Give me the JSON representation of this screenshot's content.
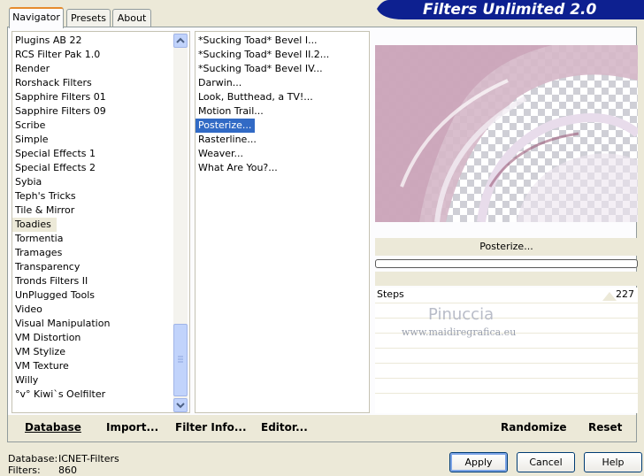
{
  "tabs": [
    "Navigator",
    "Presets",
    "About"
  ],
  "header": {
    "title": "Filters Unlimited 2.0"
  },
  "categories": [
    "Plugins AB 22",
    "RCS Filter Pak 1.0",
    "Render",
    "Rorshack Filters",
    "Sapphire Filters 01",
    "Sapphire Filters 09",
    "Scribe",
    "Simple",
    "Special Effects 1",
    "Special Effects 2",
    "Sybia",
    "Teph's Tricks",
    "Tile & Mirror",
    "Toadies",
    "Tormentia",
    "Tramages",
    "Transparency",
    "Tronds Filters II",
    "UnPlugged Tools",
    "Video",
    "Visual Manipulation",
    "VM Distortion",
    "VM Stylize",
    "VM Texture",
    "Willy",
    "°v° Kiwi`s Oelfilter"
  ],
  "selected_category": "Toadies",
  "filters": [
    "*Sucking Toad*  Bevel I...",
    "*Sucking Toad*  Bevel II.2...",
    "*Sucking Toad*  Bevel IV...",
    "Darwin...",
    "Look, Butthead, a TV!...",
    "Motion Trail...",
    "Posterize...",
    "Rasterline...",
    "Weaver...",
    "What Are You?..."
  ],
  "selected_filter": "Posterize...",
  "preview": {
    "filter_name": "Posterize...",
    "progress": 0
  },
  "param": {
    "label": "Steps",
    "value": "227"
  },
  "watermark": {
    "name": "Pinuccia",
    "url": "www.maidiregrafica.eu"
  },
  "toolbar": {
    "database": "Database",
    "import": "Import...",
    "filter_info": "Filter Info...",
    "editor": "Editor...",
    "randomize": "Randomize",
    "reset": "Reset"
  },
  "status": {
    "database_label": "Database:",
    "database_value": "ICNET-Filters",
    "filters_label": "Filters:",
    "filters_value": "860"
  },
  "buttons": {
    "apply": "Apply",
    "cancel": "Cancel",
    "help": "Help"
  },
  "colors": {
    "selection": "#316ac5",
    "title_bg": "#0d2090",
    "tab_accent": "#e68b2c"
  }
}
